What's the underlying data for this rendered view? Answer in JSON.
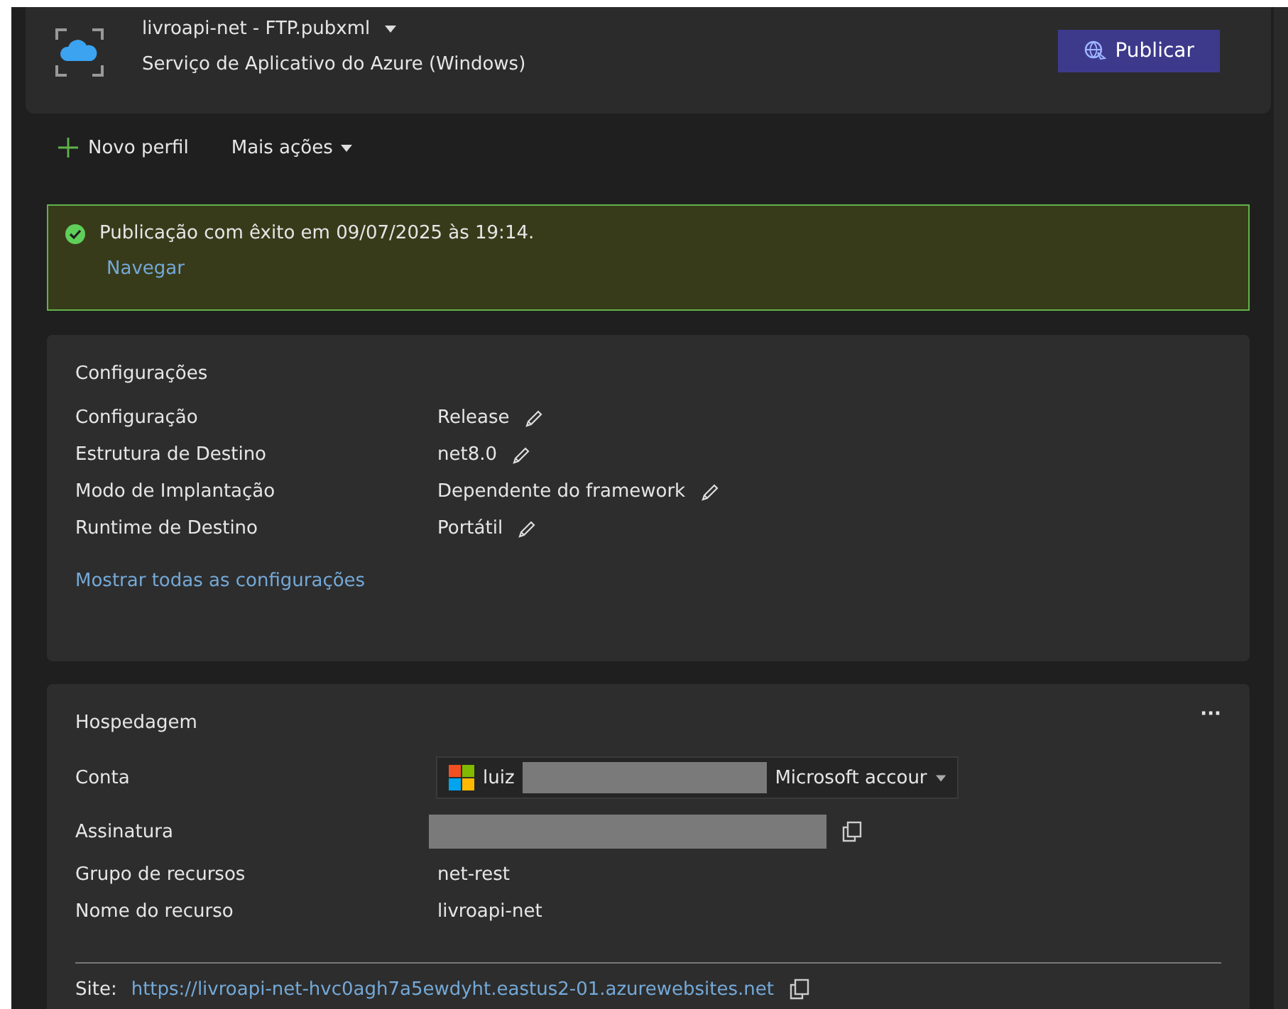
{
  "profile": {
    "name": "livroapi-net - FTP.pubxml",
    "subtitle": "Serviço de Aplicativo do Azure (Windows)",
    "publish_button": "Publicar"
  },
  "toolbar": {
    "new_profile": "Novo perfil",
    "more_actions": "Mais ações"
  },
  "banner": {
    "message": "Publicação com êxito em 09/07/2025 às 19:14.",
    "link": "Navegar"
  },
  "settings": {
    "title": "Configurações",
    "rows": [
      {
        "label": "Configuração",
        "value": "Release"
      },
      {
        "label": "Estrutura de Destino",
        "value": "net8.0"
      },
      {
        "label": "Modo de Implantação",
        "value": "Dependente do framework"
      },
      {
        "label": "Runtime de Destino",
        "value": "Portátil"
      }
    ],
    "link": "Mostrar todas as configurações"
  },
  "hosting": {
    "title": "Hospedagem",
    "more": "···",
    "rows": [
      {
        "label": "Conta",
        "kind": "account",
        "value_start": "luiz",
        "value_end": "Microsoft accour"
      },
      {
        "label": "Assinatura",
        "kind": "redacted"
      },
      {
        "label": "Grupo de recursos",
        "kind": "text",
        "value": "net-rest"
      },
      {
        "label": "Nome do recurso",
        "kind": "text",
        "value": "livroapi-net"
      }
    ],
    "site_label": "Site:",
    "site_url": "https://livroapi-net-hvc0agh7a5ewdyht.eastus2-01.azurewebsites.net"
  }
}
